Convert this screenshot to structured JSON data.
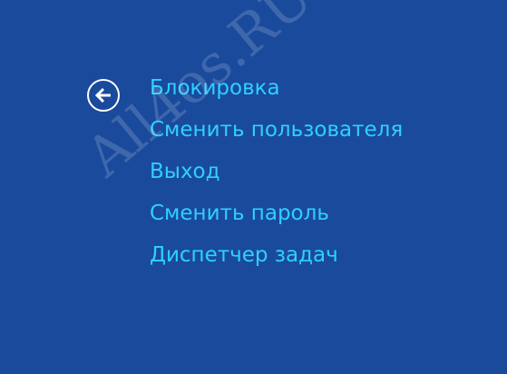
{
  "screen": {
    "background_color": "#1a4a9c",
    "accent_color": "#2ed0ff"
  },
  "back_button": {
    "icon": "back-arrow-icon"
  },
  "menu": {
    "items": [
      {
        "label": "Блокировка"
      },
      {
        "label": "Сменить пользователя"
      },
      {
        "label": "Выход"
      },
      {
        "label": "Сменить пароль"
      },
      {
        "label": "Диспетчер задач"
      }
    ]
  },
  "watermark": {
    "text": "All4os.RU"
  }
}
